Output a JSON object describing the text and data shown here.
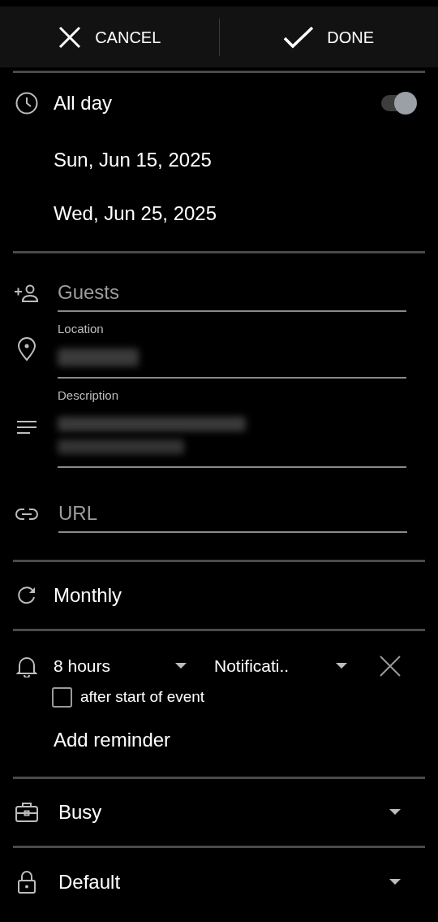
{
  "toolbar": {
    "cancel": "CANCEL",
    "done": "DONE"
  },
  "all_day": {
    "label": "All day",
    "on": true
  },
  "dates": [
    "Sun, Jun 15, 2025",
    "Wed, Jun 25, 2025"
  ],
  "guests": {
    "placeholder": "Guests"
  },
  "location": {
    "label": "Location"
  },
  "description": {
    "label": "Description"
  },
  "url": {
    "placeholder": "URL"
  },
  "repeat": "Monthly",
  "reminder": {
    "time": "8 hours",
    "method": "Notificati..",
    "after_start": {
      "label": "after start of event",
      "checked": false
    }
  },
  "add_reminder": "Add reminder",
  "availability": "Busy",
  "visibility": "Default"
}
